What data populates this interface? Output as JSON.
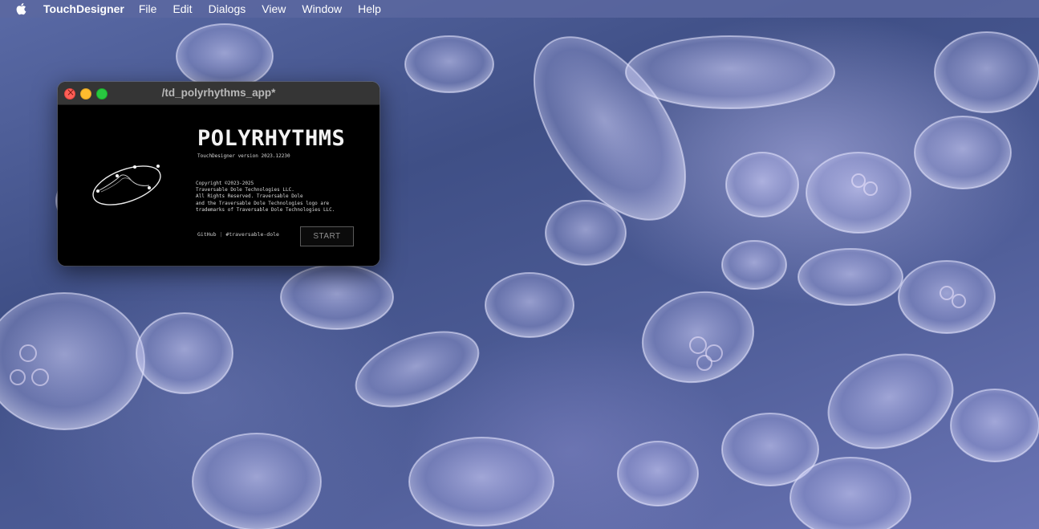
{
  "menubar": {
    "apple_icon": "apple-logo-icon",
    "app_name": "TouchDesigner",
    "items": [
      "File",
      "Edit",
      "Dialogs",
      "View",
      "Window",
      "Help"
    ]
  },
  "window": {
    "title": "/td_polyrhythms_app*",
    "traffic_colors": {
      "close": "#ff5f57",
      "minimize": "#febc2e",
      "maximize": "#28c840"
    }
  },
  "splash": {
    "app_title": "POLYRHYTHMS",
    "version": "TouchDesigner version 2023.12230",
    "copyright": "Copyright ©2023-2025\nTraversable Dole Technologies LLC.\nAll Rights Reserved. Traversable Dole\nand the Traversable Dole Technologies logo are\ntrademarks of Traversable Dole Technologies LLC.",
    "link_github": "GitHub",
    "link_separator": "|",
    "link_handle": "#traversable-dole",
    "start_button": "START",
    "logo_icon": "ellipse-orbit-logo-icon"
  },
  "colors": {
    "menubar": "#5c68a0",
    "window_bg": "#000000",
    "titlebar": "#353535"
  }
}
